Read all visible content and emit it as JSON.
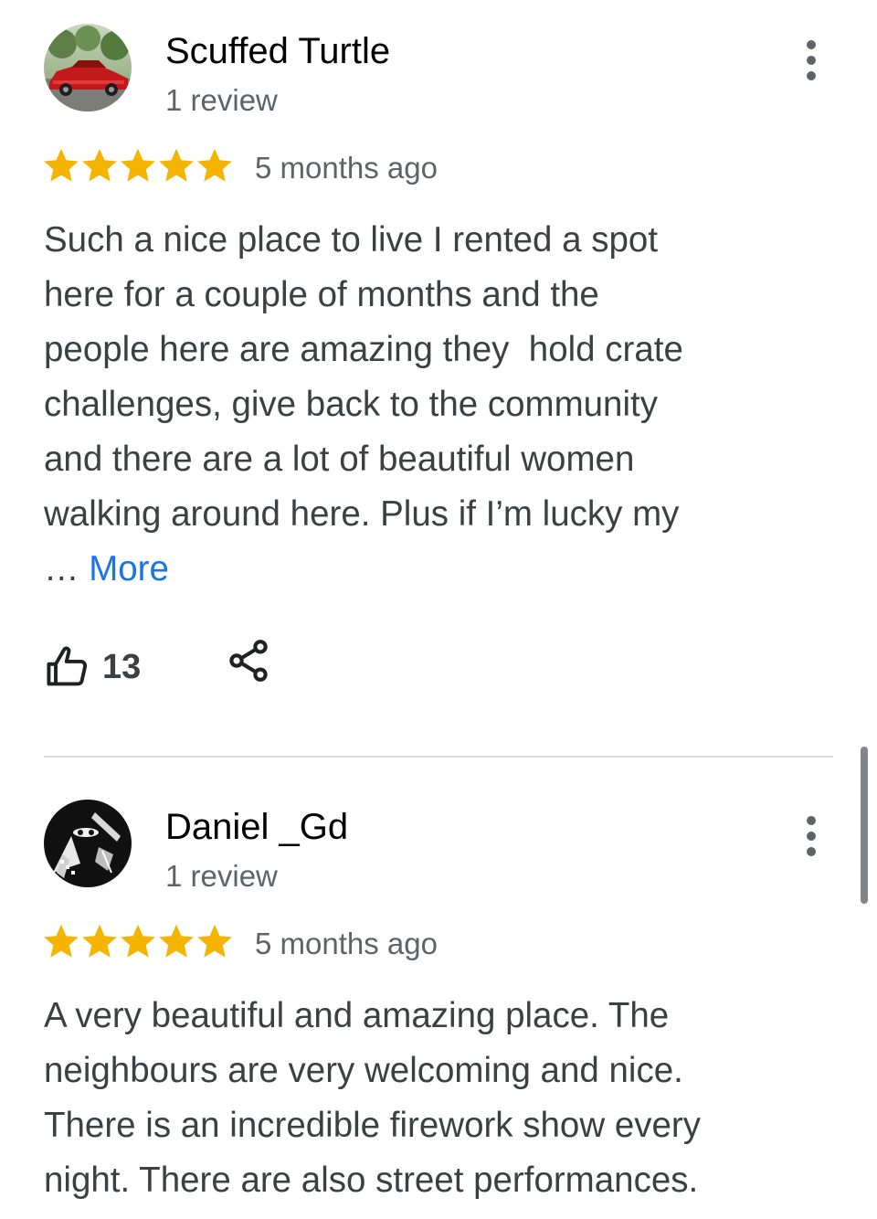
{
  "colors": {
    "star": "#f4b400",
    "link": "#1a73e8",
    "secondary_text": "#5f6368",
    "body_text": "#3c4043",
    "divider": "#dadce0"
  },
  "reviews": [
    {
      "author": "Scuffed Turtle",
      "review_count": "1 review",
      "avatar_icon": "red-car-photo",
      "rating": 5,
      "time": "5 months ago",
      "text_lines": [
        "Such a nice place to live I rented a spot",
        "here for a couple of months and the",
        "people here are amazing they  hold crate",
        "challenges, give back to the community",
        "and there are a lot of beautiful women",
        "walking around here. Plus if I’m lucky my"
      ],
      "ellipsis": "… ",
      "more_label": "More",
      "likes": "13",
      "like_icon": "thumbs-up-icon",
      "share_icon": "share-icon",
      "menu_icon": "more-vert-icon"
    },
    {
      "author": "Daniel _Gd",
      "review_count": "1 review",
      "avatar_icon": "masked-figure-graphic",
      "rating": 5,
      "time": "5 months ago",
      "text_lines": [
        "A very beautiful and amazing place. The",
        "neighbours are very welcoming and nice.",
        "There is an incredible firework show every",
        "night. There are also street performances."
      ],
      "menu_icon": "more-vert-icon"
    }
  ]
}
